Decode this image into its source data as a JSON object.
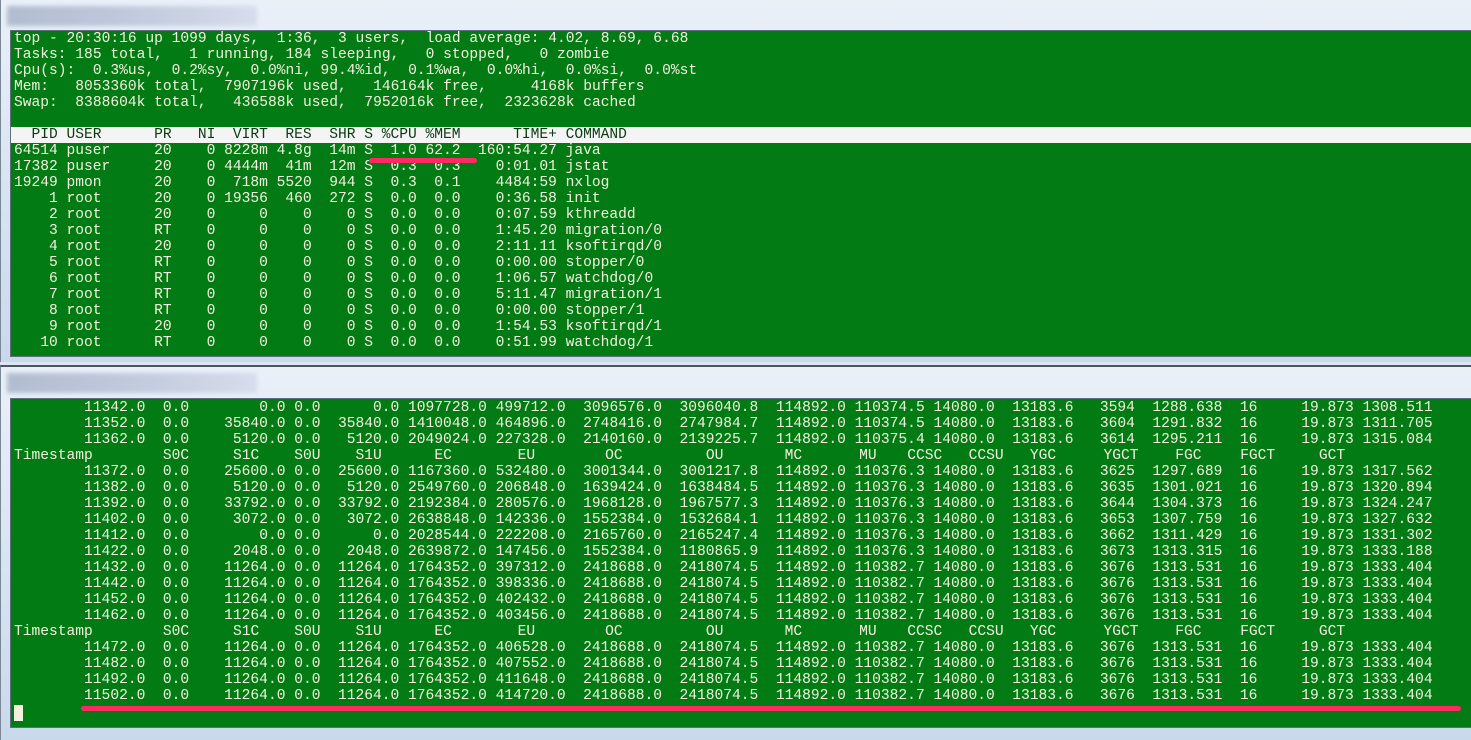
{
  "top_window": {
    "summary": [
      "top - 20:30:16 up 1099 days,  1:36,  3 users,  load average: 4.02, 8.69, 6.68",
      "Tasks: 185 total,   1 running, 184 sleeping,   0 stopped,   0 zombie",
      "Cpu(s):  0.3%us,  0.2%sy,  0.0%ni, 99.4%id,  0.1%wa,  0.0%hi,  0.0%si,  0.0%st",
      "Mem:   8053360k total,  7907196k used,   146164k free,     4168k buffers",
      "Swap:  8388604k total,   436588k used,  7952016k free,  2323628k cached"
    ],
    "columns": [
      "PID",
      "USER",
      "PR",
      "NI",
      "VIRT",
      "RES",
      "SHR",
      "S",
      "%CPU",
      "%MEM",
      "TIME+",
      "COMMAND"
    ],
    "processes": [
      [
        "64514",
        "puser",
        "20",
        "0",
        "8228m",
        "4.8g",
        "14m",
        "S",
        "1.0",
        "62.2",
        "160:54.27",
        "java"
      ],
      [
        "17382",
        "puser",
        "20",
        "0",
        "4444m",
        "41m",
        "12m",
        "S",
        "0.3",
        "0.3",
        "0:01.01",
        "jstat"
      ],
      [
        "19249",
        "pmon",
        "20",
        "0",
        "718m",
        "5520",
        "944",
        "S",
        "0.3",
        "0.1",
        "4484:59",
        "nxlog"
      ],
      [
        "1",
        "root",
        "20",
        "0",
        "19356",
        "460",
        "272",
        "S",
        "0.0",
        "0.0",
        "0:36.58",
        "init"
      ],
      [
        "2",
        "root",
        "20",
        "0",
        "0",
        "0",
        "0",
        "S",
        "0.0",
        "0.0",
        "0:07.59",
        "kthreadd"
      ],
      [
        "3",
        "root",
        "RT",
        "0",
        "0",
        "0",
        "0",
        "S",
        "0.0",
        "0.0",
        "1:45.20",
        "migration/0"
      ],
      [
        "4",
        "root",
        "20",
        "0",
        "0",
        "0",
        "0",
        "S",
        "0.0",
        "0.0",
        "2:11.11",
        "ksoftirqd/0"
      ],
      [
        "5",
        "root",
        "RT",
        "0",
        "0",
        "0",
        "0",
        "S",
        "0.0",
        "0.0",
        "0:00.00",
        "stopper/0"
      ],
      [
        "6",
        "root",
        "RT",
        "0",
        "0",
        "0",
        "0",
        "S",
        "0.0",
        "0.0",
        "1:06.57",
        "watchdog/0"
      ],
      [
        "7",
        "root",
        "RT",
        "0",
        "0",
        "0",
        "0",
        "S",
        "0.0",
        "0.0",
        "5:11.47",
        "migration/1"
      ],
      [
        "8",
        "root",
        "RT",
        "0",
        "0",
        "0",
        "0",
        "S",
        "0.0",
        "0.0",
        "0:00.00",
        "stopper/1"
      ],
      [
        "9",
        "root",
        "20",
        "0",
        "0",
        "0",
        "0",
        "S",
        "0.0",
        "0.0",
        "1:54.53",
        "ksoftirqd/1"
      ],
      [
        "10",
        "root",
        "RT",
        "0",
        "0",
        "0",
        "0",
        "S",
        "0.0",
        "0.0",
        "0:51.99",
        "watchdog/1"
      ]
    ]
  },
  "jstat_window": {
    "columns": [
      "Timestamp",
      "S0C",
      "S1C",
      "S0U",
      "S1U",
      "EC",
      "EU",
      "OC",
      "OU",
      "MC",
      "MU",
      "CCSC",
      "CCSU",
      "YGC",
      "YGCT",
      "FGC",
      "FGCT",
      "GCT"
    ],
    "blocks": [
      {
        "header": false,
        "rows": [
          [
            "11342.0",
            "0.0",
            "0.0",
            "0.0",
            "0.0",
            "1097728.0",
            "499712.0",
            "3096576.0",
            "3096040.8",
            "114892.0",
            "110374.5",
            "14080.0",
            "13183.6",
            "3594",
            "1288.638",
            "16",
            "19.873",
            "1308.511"
          ],
          [
            "11352.0",
            "0.0",
            "35840.0",
            "0.0",
            "35840.0",
            "1410048.0",
            "464896.0",
            "2748416.0",
            "2747984.7",
            "114892.0",
            "110374.5",
            "14080.0",
            "13183.6",
            "3604",
            "1291.832",
            "16",
            "19.873",
            "1311.705"
          ],
          [
            "11362.0",
            "0.0",
            "5120.0",
            "0.0",
            "5120.0",
            "2049024.0",
            "227328.0",
            "2140160.0",
            "2139225.7",
            "114892.0",
            "110375.4",
            "14080.0",
            "13183.6",
            "3614",
            "1295.211",
            "16",
            "19.873",
            "1315.084"
          ]
        ]
      },
      {
        "header": true,
        "rows": [
          [
            "11372.0",
            "0.0",
            "25600.0",
            "0.0",
            "25600.0",
            "1167360.0",
            "532480.0",
            "3001344.0",
            "3001217.8",
            "114892.0",
            "110376.3",
            "14080.0",
            "13183.6",
            "3625",
            "1297.689",
            "16",
            "19.873",
            "1317.562"
          ],
          [
            "11382.0",
            "0.0",
            "5120.0",
            "0.0",
            "5120.0",
            "2549760.0",
            "206848.0",
            "1639424.0",
            "1638484.5",
            "114892.0",
            "110376.3",
            "14080.0",
            "13183.6",
            "3635",
            "1301.021",
            "16",
            "19.873",
            "1320.894"
          ],
          [
            "11392.0",
            "0.0",
            "33792.0",
            "0.0",
            "33792.0",
            "2192384.0",
            "280576.0",
            "1968128.0",
            "1967577.3",
            "114892.0",
            "110376.3",
            "14080.0",
            "13183.6",
            "3644",
            "1304.373",
            "16",
            "19.873",
            "1324.247"
          ],
          [
            "11402.0",
            "0.0",
            "3072.0",
            "0.0",
            "3072.0",
            "2638848.0",
            "142336.0",
            "1552384.0",
            "1532684.1",
            "114892.0",
            "110376.3",
            "14080.0",
            "13183.6",
            "3653",
            "1307.759",
            "16",
            "19.873",
            "1327.632"
          ],
          [
            "11412.0",
            "0.0",
            "0.0",
            "0.0",
            "0.0",
            "2028544.0",
            "222208.0",
            "2165760.0",
            "2165247.4",
            "114892.0",
            "110376.3",
            "14080.0",
            "13183.6",
            "3662",
            "1311.429",
            "16",
            "19.873",
            "1331.302"
          ],
          [
            "11422.0",
            "0.0",
            "2048.0",
            "0.0",
            "2048.0",
            "2639872.0",
            "147456.0",
            "1552384.0",
            "1180865.9",
            "114892.0",
            "110376.3",
            "14080.0",
            "13183.6",
            "3673",
            "1313.315",
            "16",
            "19.873",
            "1333.188"
          ],
          [
            "11432.0",
            "0.0",
            "11264.0",
            "0.0",
            "11264.0",
            "1764352.0",
            "397312.0",
            "2418688.0",
            "2418074.5",
            "114892.0",
            "110382.7",
            "14080.0",
            "13183.6",
            "3676",
            "1313.531",
            "16",
            "19.873",
            "1333.404"
          ],
          [
            "11442.0",
            "0.0",
            "11264.0",
            "0.0",
            "11264.0",
            "1764352.0",
            "398336.0",
            "2418688.0",
            "2418074.5",
            "114892.0",
            "110382.7",
            "14080.0",
            "13183.6",
            "3676",
            "1313.531",
            "16",
            "19.873",
            "1333.404"
          ],
          [
            "11452.0",
            "0.0",
            "11264.0",
            "0.0",
            "11264.0",
            "1764352.0",
            "402432.0",
            "2418688.0",
            "2418074.5",
            "114892.0",
            "110382.7",
            "14080.0",
            "13183.6",
            "3676",
            "1313.531",
            "16",
            "19.873",
            "1333.404"
          ],
          [
            "11462.0",
            "0.0",
            "11264.0",
            "0.0",
            "11264.0",
            "1764352.0",
            "403456.0",
            "2418688.0",
            "2418074.5",
            "114892.0",
            "110382.7",
            "14080.0",
            "13183.6",
            "3676",
            "1313.531",
            "16",
            "19.873",
            "1333.404"
          ]
        ]
      },
      {
        "header": true,
        "rows": [
          [
            "11472.0",
            "0.0",
            "11264.0",
            "0.0",
            "11264.0",
            "1764352.0",
            "406528.0",
            "2418688.0",
            "2418074.5",
            "114892.0",
            "110382.7",
            "14080.0",
            "13183.6",
            "3676",
            "1313.531",
            "16",
            "19.873",
            "1333.404"
          ],
          [
            "11482.0",
            "0.0",
            "11264.0",
            "0.0",
            "11264.0",
            "1764352.0",
            "407552.0",
            "2418688.0",
            "2418074.5",
            "114892.0",
            "110382.7",
            "14080.0",
            "13183.6",
            "3676",
            "1313.531",
            "16",
            "19.873",
            "1333.404"
          ],
          [
            "11492.0",
            "0.0",
            "11264.0",
            "0.0",
            "11264.0",
            "1764352.0",
            "411648.0",
            "2418688.0",
            "2418074.5",
            "114892.0",
            "110382.7",
            "14080.0",
            "13183.6",
            "3676",
            "1313.531",
            "16",
            "19.873",
            "1333.404"
          ],
          [
            "11502.0",
            "0.0",
            "11264.0",
            "0.0",
            "11264.0",
            "1764352.0",
            "414720.0",
            "2418688.0",
            "2418074.5",
            "114892.0",
            "110382.7",
            "14080.0",
            "13183.6",
            "3676",
            "1313.531",
            "16",
            "19.873",
            "1333.404"
          ]
        ]
      }
    ]
  },
  "colors": {
    "terminal_bg": "#037b14",
    "terminal_fg": "#f2f2dc",
    "annotation": "#ff2a63"
  }
}
